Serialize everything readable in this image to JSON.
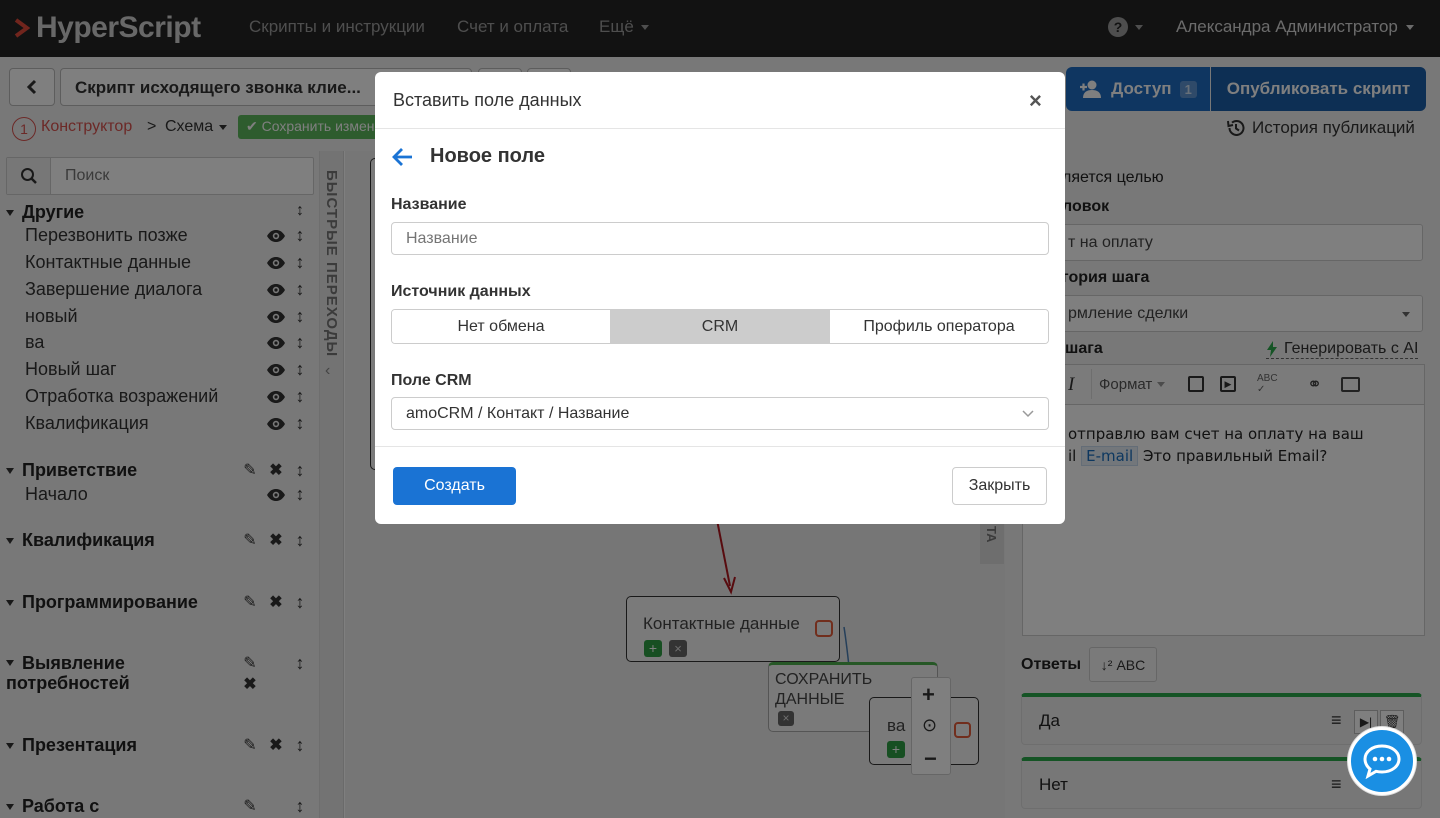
{
  "topnav": {
    "logo_text": "HyperScript",
    "links": [
      "Скрипты и инструкции",
      "Счет и оплата",
      "Ещё"
    ],
    "user": "Александра Администратор"
  },
  "toolbar": {
    "script_title": "Скрипт исходящего звонка клие...",
    "access_label": "Доступ",
    "access_count": "1",
    "publish_label": "Опубликовать скрипт",
    "history_label": "История публикаций",
    "step_number": "1",
    "crumb_constructor": "Конструктор",
    "crumb_sep": ">",
    "crumb_schema": "Схема",
    "save_label": "Сохранить измен"
  },
  "sidebar": {
    "search_placeholder": "Поиск",
    "groups": [
      {
        "label": "Другие",
        "items": [
          "Перезвонить позже",
          "Контактные данные",
          "Завершение диалога",
          "новый",
          "ва",
          "Новый шаг",
          "Отработка возражений",
          "Квалификация"
        ]
      },
      {
        "label": "Приветствие",
        "items": [
          "Начало"
        ]
      },
      {
        "label": "Квалификация",
        "items": []
      },
      {
        "label": "Программирование",
        "items": []
      },
      {
        "label": "Выявление потребностей",
        "items": []
      },
      {
        "label": "Презентация",
        "items": []
      },
      {
        "label": "Работа с",
        "items": []
      }
    ],
    "quick_label": "БЫСТРЫЕ ПЕРЕХОДЫ"
  },
  "canvas": {
    "node_contact": "Контактные данные",
    "node_save": "СОХРАНИТЬ ДАННЫЕ",
    "node_va": "ва",
    "side_tab": "ТА"
  },
  "right_panel": {
    "goal_text": "ляется целью",
    "title_label": "ловок",
    "title_value": "т на оплату",
    "category_label": "гория шага",
    "category_value": "рмление сделки",
    "text_label": "шага",
    "generate_label": "Генерировать с AI",
    "format_label": "Формат",
    "editor_line1": "отправлю вам счет на оплату на ваш",
    "editor_line2_pre": "il",
    "editor_chip": "E-mail",
    "editor_line2_post": "Это правильный Email?",
    "answers_label": "Ответы",
    "sort_label": "ABC",
    "answers": [
      "Да",
      "Нет"
    ]
  },
  "modal": {
    "title": "Вставить поле данных",
    "subtitle": "Новое поле",
    "name_label": "Название",
    "name_placeholder": "Название",
    "source_label": "Источник данных",
    "source_options": [
      "Нет обмена",
      "CRM",
      "Профиль оператора"
    ],
    "source_selected": "CRM",
    "crm_field_label": "Поле CRM",
    "crm_field_value": "amoCRM / Контакт / Название",
    "create_label": "Создать",
    "close_label": "Закрыть"
  },
  "colors": {
    "accent_blue": "#1a73d4",
    "publish_blue": "#1a5ea8",
    "danger_red": "#d9534f",
    "success_green": "#5cb85c"
  }
}
